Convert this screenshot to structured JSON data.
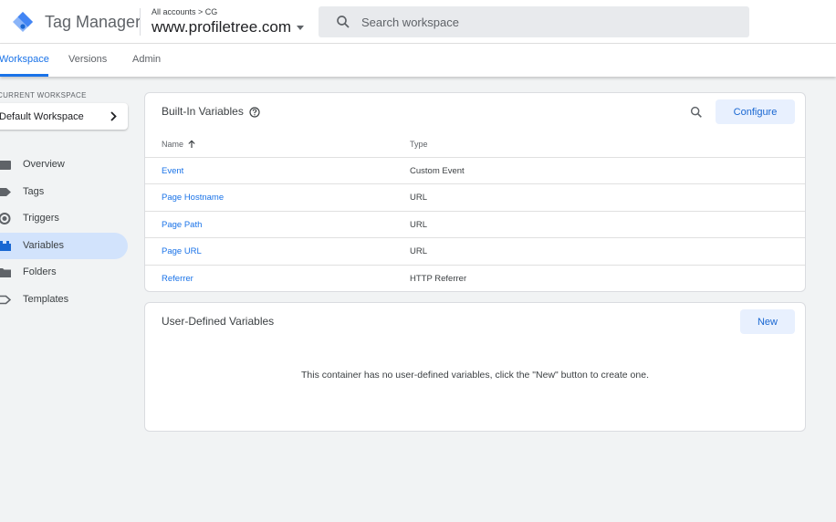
{
  "header": {
    "product_name": "Tag Manager",
    "breadcrumb": "All accounts > CG",
    "container_name": "www.profiletree.com",
    "search_placeholder": "Search workspace"
  },
  "tabs": [
    {
      "label": "Workspace",
      "active": true
    },
    {
      "label": "Versions",
      "active": false
    },
    {
      "label": "Admin",
      "active": false
    }
  ],
  "sidebar": {
    "workspace_label": "CURRENT WORKSPACE",
    "workspace_name": "Default Workspace",
    "items": [
      {
        "label": "Overview",
        "icon": "overview-icon",
        "active": false
      },
      {
        "label": "Tags",
        "icon": "tag-icon",
        "active": false
      },
      {
        "label": "Triggers",
        "icon": "trigger-icon",
        "active": false
      },
      {
        "label": "Variables",
        "icon": "variables-icon",
        "active": true
      },
      {
        "label": "Folders",
        "icon": "folder-icon",
        "active": false
      },
      {
        "label": "Templates",
        "icon": "template-icon",
        "active": false
      }
    ]
  },
  "builtin": {
    "title": "Built-In Variables",
    "configure_label": "Configure",
    "columns": [
      "Name",
      "Type"
    ],
    "rows": [
      {
        "name": "Event",
        "type": "Custom Event"
      },
      {
        "name": "Page Hostname",
        "type": "URL"
      },
      {
        "name": "Page Path",
        "type": "URL"
      },
      {
        "name": "Page URL",
        "type": "URL"
      },
      {
        "name": "Referrer",
        "type": "HTTP Referrer"
      }
    ]
  },
  "user_defined": {
    "title": "User-Defined Variables",
    "new_label": "New",
    "empty_message": "This container has no user-defined variables, click the \"New\" button to create one."
  },
  "colors": {
    "accent": "#1a73e8",
    "active_nav_bg": "#d2e3fc",
    "button_bg": "#e8f0fe",
    "page_bg": "#f1f3f4"
  }
}
